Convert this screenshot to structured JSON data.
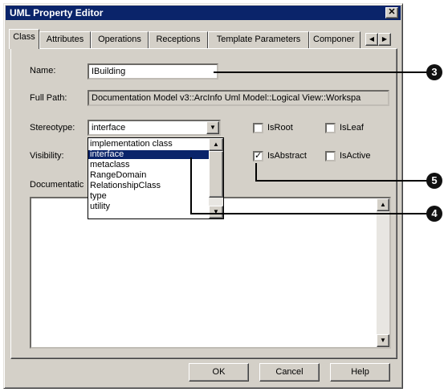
{
  "window": {
    "title": "UML Property Editor",
    "close_glyph": "✕"
  },
  "tabs": [
    "Class",
    "Attributes",
    "Operations",
    "Receptions",
    "Template Parameters",
    "Componer"
  ],
  "tab_scroll": {
    "left": "◀",
    "right": "▶"
  },
  "form": {
    "name_label": "Name:",
    "name_value": "IBuilding",
    "fullpath_label": "Full Path:",
    "fullpath_value": "Documentation Model v3::ArcInfo Uml Model::Logical View::Workspa",
    "stereotype_label": "Stereotype:",
    "stereotype_value": "interface",
    "visibility_label": "Visibility:",
    "documentation_label": "Documentatic"
  },
  "stereotype_options": [
    "implementation class",
    "interface",
    "metaclass",
    "RangeDomain",
    "RelationshipClass",
    "type",
    "utility"
  ],
  "stereotype_selected_index": 1,
  "checkboxes": {
    "isroot": {
      "label": "IsRoot",
      "checked": false
    },
    "isleaf": {
      "label": "IsLeaf",
      "checked": false
    },
    "isabstract": {
      "label": "IsAbstract",
      "checked": true
    },
    "isactive": {
      "label": "IsActive",
      "checked": false
    }
  },
  "check_glyph": "✓",
  "buttons": {
    "ok": "OK",
    "cancel": "Cancel",
    "help": "Help"
  },
  "callouts": {
    "c3": "3",
    "c4": "4",
    "c5": "5"
  },
  "glyphs": {
    "down": "▼",
    "up": "▲"
  }
}
